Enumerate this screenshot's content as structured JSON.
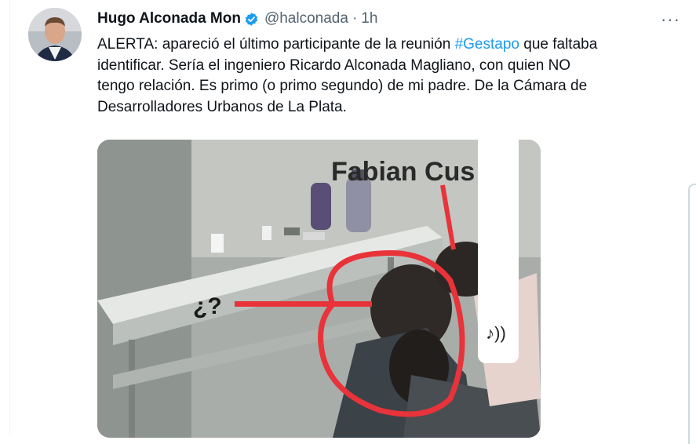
{
  "tweet": {
    "display_name": "Hugo Alconada Mon",
    "handle": "@halconada",
    "separator": "·",
    "time": "1h",
    "more_label": "···",
    "text_lines": [
      [
        "ALERTA: apareció el último participante de la reunión ",
        "#Gestapo",
        " que faltaba"
      ],
      "identificar. Sería el ingeniero Ricardo Alconada Magliano, con quien NO",
      "tengo relación. Es primo (o primo segundo) de mi padre. De la Cámara de",
      "Desarrolladores Urbanos de La Plata."
    ]
  },
  "media": {
    "overlay_name": "Fabian Cus",
    "question_label": "¿?",
    "audio_icon": "♪))"
  },
  "colors": {
    "link": "#1d9bf0",
    "verified": "#1d9bf0",
    "muted": "#536471",
    "annotation_red": "#e8333a"
  }
}
